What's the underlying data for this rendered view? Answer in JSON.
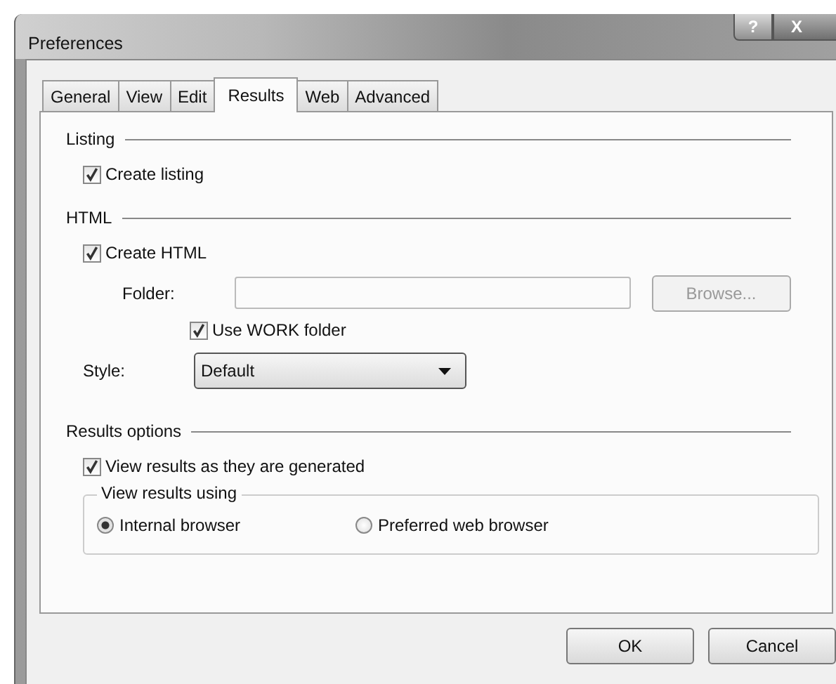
{
  "window": {
    "title": "Preferences",
    "help_button": "?",
    "close_button": "X"
  },
  "tabs": [
    {
      "label": "General",
      "selected": false
    },
    {
      "label": "View",
      "selected": false
    },
    {
      "label": "Edit",
      "selected": false
    },
    {
      "label": "Results",
      "selected": true
    },
    {
      "label": "Web",
      "selected": false
    },
    {
      "label": "Advanced",
      "selected": false
    }
  ],
  "listing": {
    "heading": "Listing",
    "create_listing": {
      "label": "Create listing",
      "checked": true
    }
  },
  "html": {
    "heading": "HTML",
    "create_html": {
      "label": "Create HTML",
      "checked": true
    },
    "folder": {
      "label": "Folder:"
    },
    "browse_button": {
      "label": "Browse...",
      "disabled": true
    },
    "use_work_folder": {
      "label": "Use WORK folder",
      "checked": true
    },
    "style": {
      "label": "Style:",
      "value": "Default"
    }
  },
  "results_options": {
    "heading": "Results options",
    "view_as_generated": {
      "label": "View results as they are generated",
      "checked": true
    },
    "view_using": {
      "legend": "View results using",
      "options": [
        {
          "label": "Internal browser",
          "selected": true
        },
        {
          "label": "Preferred web browser",
          "selected": false
        }
      ]
    }
  },
  "buttons": [
    {
      "label": "OK"
    },
    {
      "label": "Cancel"
    }
  ]
}
